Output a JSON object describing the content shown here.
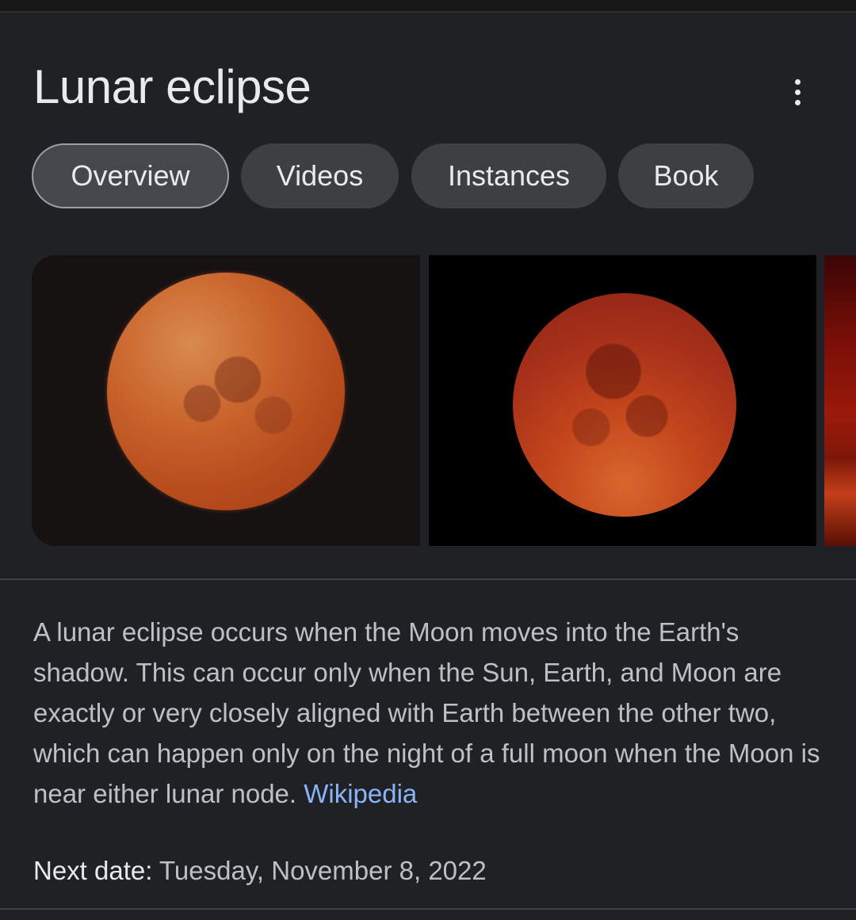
{
  "title": "Lunar eclipse",
  "more_icon": "more-vert-icon",
  "tabs": [
    {
      "label": "Overview",
      "active": true
    },
    {
      "label": "Videos",
      "active": false
    },
    {
      "label": "Instances",
      "active": false
    },
    {
      "label": "Book",
      "active": false
    }
  ],
  "description": {
    "text": "A lunar eclipse occurs when the Moon moves into the Earth's shadow. This can occur only when the Sun, Earth, and Moon are exactly or very closely aligned with Earth between the other two, which can happen only on the night of a full moon when the Moon is near either lunar node.",
    "source_link": "Wikipedia"
  },
  "next_date": {
    "label": "Next date:",
    "value": "Tuesday, November 8, 2022"
  },
  "colors": {
    "background": "#202124",
    "text_primary": "#e8eaed",
    "text_secondary": "#bdc1c6",
    "link": "#8ab4f8",
    "chip": "#3c4043"
  }
}
